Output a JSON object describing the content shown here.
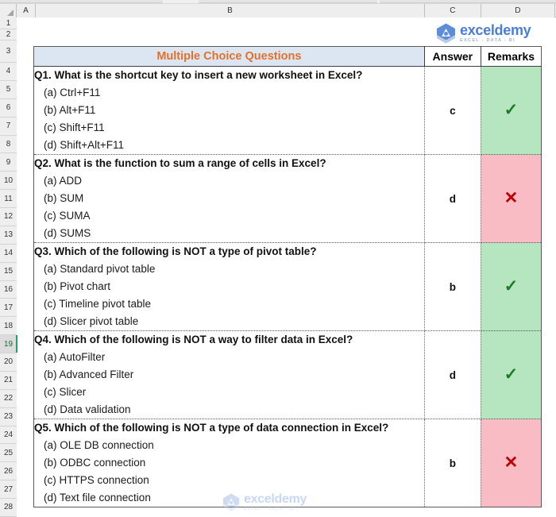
{
  "spreadsheet": {
    "column_headers": [
      "A",
      "B",
      "C",
      "D"
    ],
    "row_numbers": [
      "1",
      "2",
      "3",
      "4",
      "5",
      "6",
      "7",
      "8",
      "9",
      "10",
      "11",
      "12",
      "13",
      "14",
      "15",
      "16",
      "17",
      "18",
      "19",
      "20",
      "21",
      "22",
      "23",
      "24",
      "25",
      "26",
      "27",
      "28"
    ],
    "active_row": "19"
  },
  "brand": {
    "name": "exceldemy",
    "tagline": "EXCEL - DATA - BI",
    "logo_icon": "exceldemy-hexagon-logo",
    "color": "#4a7ddb"
  },
  "table": {
    "title": "Multiple Choice Questions",
    "title_bg": "#dce6f2",
    "title_color": "#e3702a",
    "headers": {
      "answer": "Answer",
      "remarks": "Remarks"
    },
    "colors": {
      "correct_bg": "#b5e6bf",
      "incorrect_bg": "#f9bcc4",
      "tick_color": "#1d7a24",
      "cross_color": "#c00000"
    },
    "questions": [
      {
        "question": "Q1. What is the shortcut key to insert a new worksheet in Excel?",
        "options": [
          "(a) Ctrl+F11",
          "(b) Alt+F11",
          "(c) Shift+F11",
          "(d) Shift+Alt+F11"
        ],
        "answer": "c",
        "remark": "✓",
        "remark_icon": "check-mark-icon",
        "status": "correct"
      },
      {
        "question": "Q2. What is the function to sum a range of cells in Excel?",
        "options": [
          "(a) ADD",
          "(b) SUM",
          "(c) SUMA",
          "(d) SUMS"
        ],
        "answer": "d",
        "remark": "✕",
        "remark_icon": "cross-mark-icon",
        "status": "incorrect"
      },
      {
        "question": "Q3. Which of the following is NOT a type of pivot table?",
        "options": [
          "(a) Standard pivot table",
          "(b) Pivot chart",
          "(c) Timeline pivot table",
          "(d) Slicer pivot table"
        ],
        "answer": "b",
        "remark": "✓",
        "remark_icon": "check-mark-icon",
        "status": "correct"
      },
      {
        "question": "Q4. Which of the following is NOT a way to filter data in Excel?",
        "options": [
          "(a) AutoFilter",
          "(b) Advanced Filter",
          "(c) Slicer",
          "(d) Data validation"
        ],
        "answer": "d",
        "remark": "✓",
        "remark_icon": "check-mark-icon",
        "status": "correct"
      },
      {
        "question": "Q5. Which of the following is NOT a type of data connection in Excel?",
        "options": [
          "(a) OLE DB connection",
          "(b) ODBC connection",
          "(c) HTTPS connection",
          "(d) Text file connection"
        ],
        "answer": "b",
        "remark": "✕",
        "remark_icon": "cross-mark-icon",
        "status": "incorrect"
      }
    ]
  }
}
